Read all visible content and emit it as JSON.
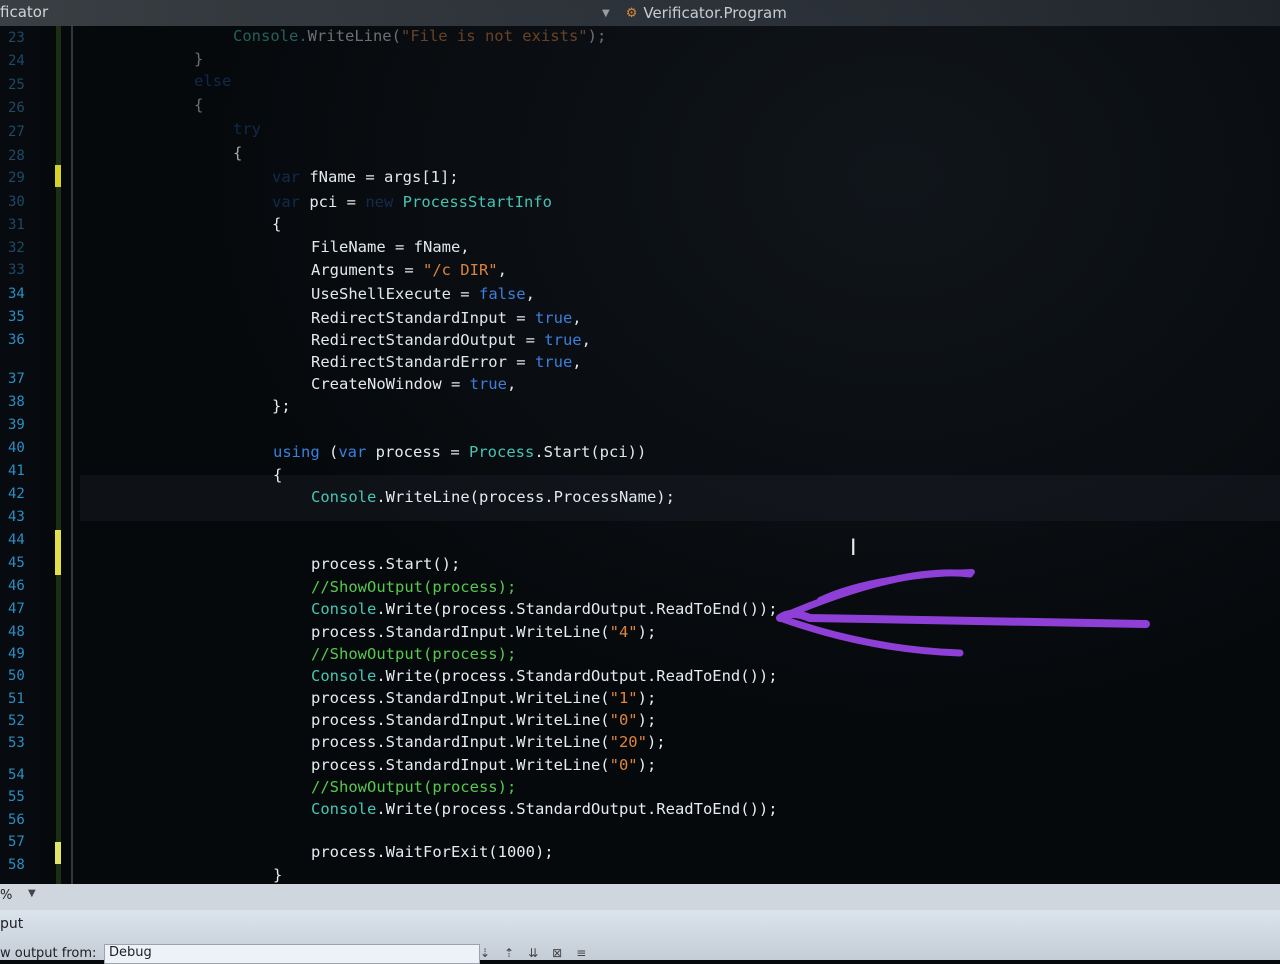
{
  "window": {
    "project_label": "ficator",
    "navigation_label": "Verificator.Program"
  },
  "gutter_numbers": [
    "23",
    "24",
    "25",
    "26",
    "27",
    "28",
    "29",
    "30",
    "31",
    "32",
    "33",
    "34",
    "35",
    "36",
    "37",
    "38",
    "39",
    "40",
    "41",
    "42",
    "43",
    "44",
    "45",
    "46",
    "47",
    "48",
    "49",
    "50",
    "51",
    "52",
    "53",
    "54",
    "55",
    "56",
    "57",
    "58"
  ],
  "code": {
    "l23": {
      "t1": "Console.",
      "t2": "WriteLine(",
      "t3": "\"File is not exists\"",
      "t4": ");"
    },
    "l24": "}",
    "l25": "else",
    "l26": "{",
    "l27": "try",
    "l28": "{",
    "l29": {
      "kw": "var",
      "rest": " fName = args[1];"
    },
    "l30": {
      "kw": "var",
      "mid": " pci = ",
      "kw2": "new",
      "tp": " ProcessStartInfo"
    },
    "l31": "{",
    "l32": "FileName = fName,",
    "l33": {
      "a": "Arguments = ",
      "s": "\"/c DIR\"",
      "b": ","
    },
    "l34": {
      "a": "UseShellExecute = ",
      "k": "false",
      "b": ","
    },
    "l35": {
      "a": "RedirectStandardInput = ",
      "k": "true",
      "b": ","
    },
    "l36": {
      "a": "RedirectStandardOutput = ",
      "k": "true",
      "b": ","
    },
    "l37": {
      "a": "RedirectStandardError = ",
      "k": "true",
      "b": ","
    },
    "l38": {
      "a": "CreateNoWindow = ",
      "k": "true",
      "b": ","
    },
    "l39": "};",
    "l41": {
      "kw": "using",
      "p1": " (",
      "kw2": "var",
      "p2": " process = ",
      "tp": "Process",
      "p3": ".Start(pci))"
    },
    "l42": "{",
    "l43": {
      "tp": "Console",
      "rest": ".WriteLine(process.ProcessName);"
    },
    "l46": "process.Start();",
    "l47": "//ShowOutput(process);",
    "l48": {
      "tp": "Console",
      "rest": ".Write(process.StandardOutput.ReadToEnd());"
    },
    "l49": {
      "a": "process.StandardInput.WriteLine(",
      "s": "\"4\"",
      "b": ");"
    },
    "l50": "//ShowOutput(process);",
    "l51": {
      "tp": "Console",
      "rest": ".Write(process.StandardOutput.ReadToEnd());"
    },
    "l52": {
      "a": "process.StandardInput.WriteLine(",
      "s": "\"1\"",
      "b": ");"
    },
    "l53": {
      "a": "process.StandardInput.WriteLine(",
      "s": "\"0\"",
      "b": ");"
    },
    "l54": {
      "a": "process.StandardInput.WriteLine(",
      "s": "\"20\"",
      "b": ");"
    },
    "l55": {
      "a": "process.StandardInput.WriteLine(",
      "s": "\"0\"",
      "b": ");"
    },
    "l56": "//ShowOutput(process);",
    "l57": {
      "tp": "Console",
      "rest": ".Write(process.StandardOutput.ReadToEnd());"
    },
    "l59": "process.WaitForExit(1000);",
    "l60": "}"
  },
  "status": {
    "zoom": "%"
  },
  "output_panel": {
    "title": "put",
    "show_from_label": "w output from:",
    "show_from_value": "Debug"
  },
  "colors": {
    "keyword": "#3b7fe0",
    "type": "#46c7b4",
    "string": "#e0843c",
    "comment": "#56c94e",
    "annotation_arrow": "#8e3fd6"
  }
}
